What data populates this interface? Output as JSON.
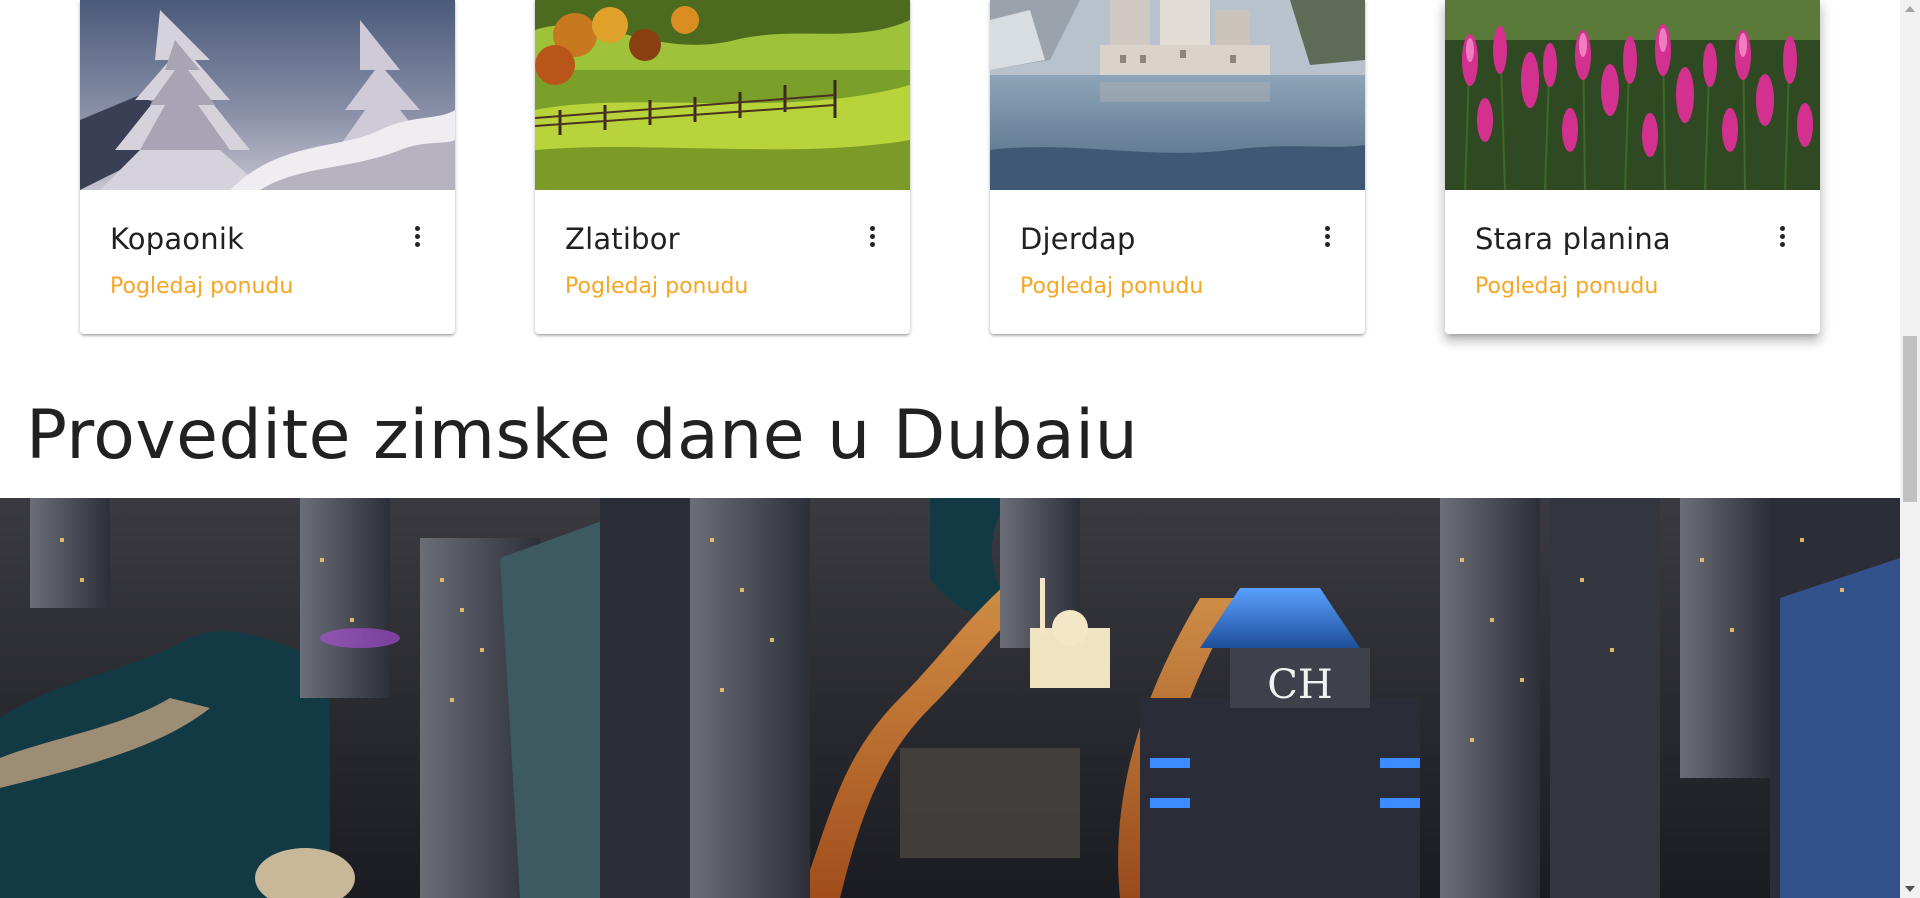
{
  "cards": [
    {
      "title": "Kopaonik",
      "link": "Pogledaj ponudu",
      "image": "snowy-pine-trees"
    },
    {
      "title": "Zlatibor",
      "link": "Pogledaj ponudu",
      "image": "green-meadow-fence"
    },
    {
      "title": "Djerdap",
      "link": "Pogledaj ponudu",
      "image": "fortress-on-river"
    },
    {
      "title": "Stara planina",
      "link": "Pogledaj ponudu",
      "image": "pink-wildflowers"
    }
  ],
  "menu_icon": "more-vert-icon",
  "section": {
    "title": "Provedite zimske dane u Dubaiu",
    "hero_image": "dubai-marina-night-aerial"
  },
  "colors": {
    "link": "#f5a623",
    "text": "#212121",
    "background": "#ffffff"
  }
}
